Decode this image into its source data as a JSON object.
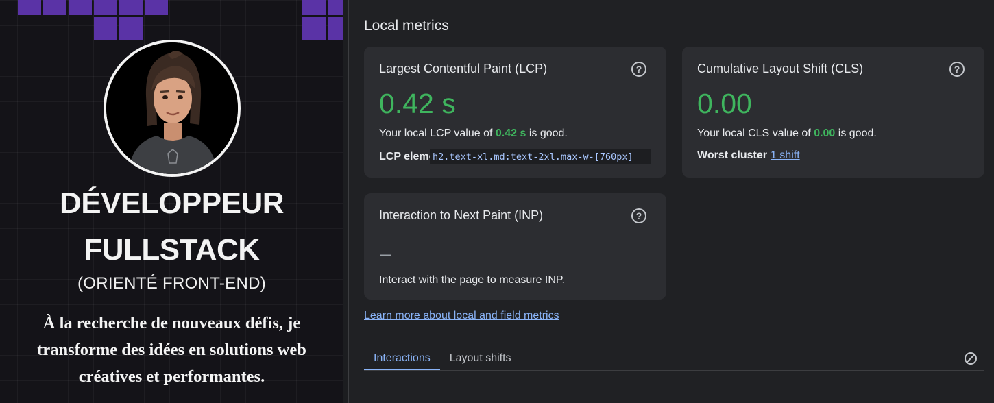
{
  "site": {
    "title_line1": "DÉVELOPPEUR",
    "title_line2": "FULLSTACK",
    "subtitle": "(ORIENTÉ FRONT-END)",
    "description": "À la recherche de nouveaux défis, je transforme des idées en solutions web créatives et performantes.",
    "accent_color": "#5a33a6"
  },
  "devtools": {
    "heading": "Local metrics",
    "lcp": {
      "title": "Largest Contentful Paint (LCP)",
      "value": "0.42 s",
      "desc_prefix": "Your local LCP value of ",
      "desc_value": "0.42 s",
      "desc_suffix": " is good.",
      "element_label": "LCP element",
      "element_node": "h2.text-xl.md:text-2xl.max-w-[760px]"
    },
    "cls": {
      "title": "Cumulative Layout Shift (CLS)",
      "value": "0.00",
      "desc_prefix": "Your local CLS value of ",
      "desc_value": "0.00",
      "desc_suffix": " is good.",
      "cluster_label": "Worst cluster",
      "cluster_link": "1 shift"
    },
    "inp": {
      "title": "Interaction to Next Paint (INP)",
      "value": "–",
      "desc": "Interact with the page to measure INP."
    },
    "learn_more": "Learn more about local and field metrics",
    "tabs": [
      {
        "label": "Interactions",
        "active": true
      },
      {
        "label": "Layout shifts",
        "active": false
      }
    ],
    "help_glyph": "?",
    "good_color": "#3fb55e",
    "link_color": "#8ab4f8"
  }
}
